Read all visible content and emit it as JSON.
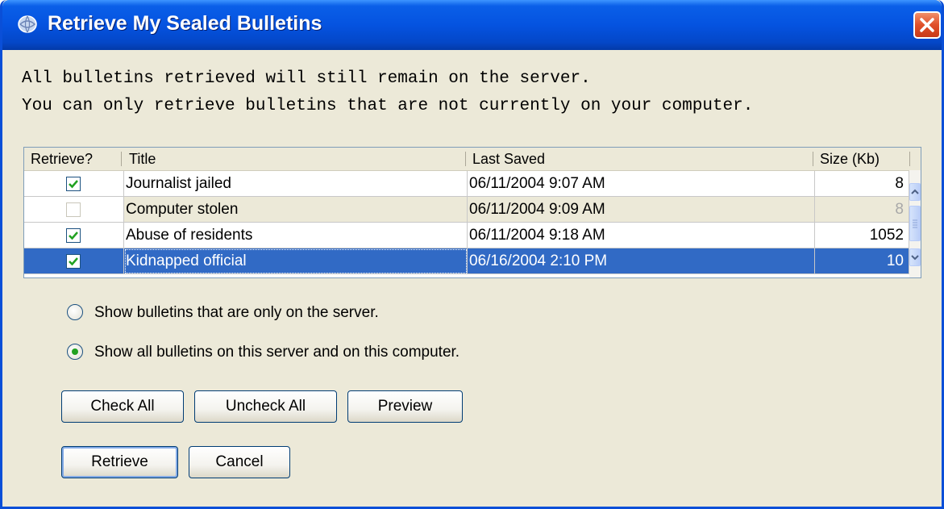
{
  "window": {
    "title": "Retrieve My Sealed Bulletins",
    "close_icon": "close-icon",
    "app_icon": "globe-app-icon"
  },
  "message": {
    "line1": "All bulletins retrieved will still remain on the server.",
    "line2": "You can only retrieve bulletins that are not currently on your computer."
  },
  "table": {
    "headers": {
      "retrieve": "Retrieve?",
      "title": "Title",
      "last_saved": "Last Saved",
      "size": "Size (Kb)"
    },
    "rows": [
      {
        "checked": true,
        "title": "Journalist jailed",
        "last_saved": "06/11/2004 9:07 AM",
        "size": "8",
        "state": "normal"
      },
      {
        "checked": false,
        "title": "Computer stolen",
        "last_saved": "06/11/2004 9:09 AM",
        "size": "8",
        "state": "disabled"
      },
      {
        "checked": true,
        "title": "Abuse of residents",
        "last_saved": "06/11/2004 9:18 AM",
        "size": "1052",
        "state": "normal"
      },
      {
        "checked": true,
        "title": "Kidnapped official",
        "last_saved": "06/16/2004 2:10 PM",
        "size": "10",
        "state": "selected"
      }
    ]
  },
  "filter": {
    "option_server_only": "Show bulletins that are only on the server.",
    "option_all": "Show all bulletins on this server and on this computer.",
    "selected": "all"
  },
  "buttons": {
    "check_all": "Check All",
    "uncheck_all": "Uncheck All",
    "preview": "Preview",
    "retrieve": "Retrieve",
    "cancel": "Cancel"
  },
  "colors": {
    "title_bar": "#0553E0",
    "selection": "#316AC5",
    "dialog_bg": "#ECE9D8",
    "check": "#21A121"
  }
}
